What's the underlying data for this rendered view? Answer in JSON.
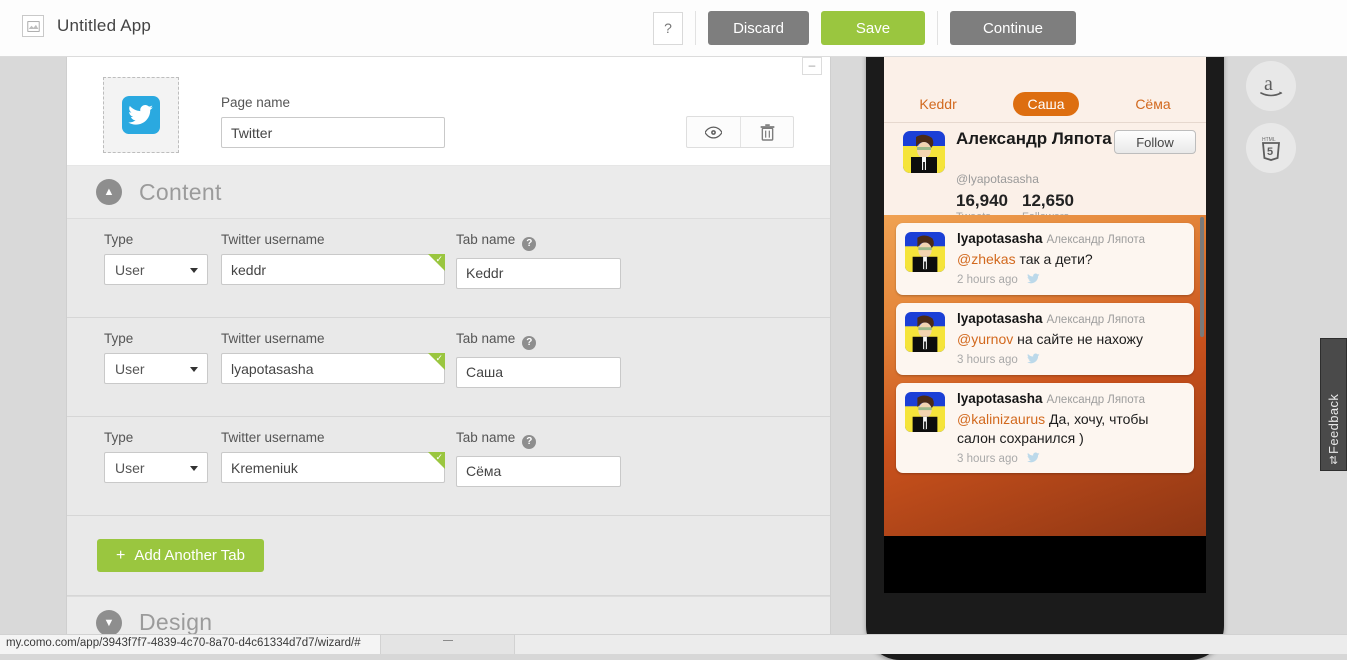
{
  "topbar": {
    "app_icon": "image-placeholder-icon",
    "app_title": "Untitled App",
    "help_label": "?",
    "discard_label": "Discard",
    "save_label": "Save",
    "continue_label": "Continue",
    "save_color": "#9ac63f",
    "grey_color": "#7e7e7e"
  },
  "panel": {
    "minimize_label": "–",
    "page_icon": "twitter-icon",
    "page_name_label": "Page name",
    "page_name_value": "Twitter",
    "preview_icon": "eye-icon",
    "delete_icon": "trash-icon"
  },
  "sections": {
    "content": {
      "title": "Content",
      "chevron": "chevron-up-icon",
      "expanded": true
    },
    "design": {
      "title": "Design",
      "chevron": "chevron-down-icon",
      "expanded": false
    }
  },
  "fields": {
    "type_label": "Type",
    "username_label": "Twitter username",
    "tabname_label": "Tab name",
    "help_badge": "?",
    "valid_mark": "✓"
  },
  "tabs": [
    {
      "type": "User",
      "username": "keddr",
      "tabname": "Keddr",
      "valid": true
    },
    {
      "type": "User",
      "username": "lyapotasasha",
      "tabname": "Саша",
      "valid": true
    },
    {
      "type": "User",
      "username": "Kremeniuk",
      "tabname": "Сёма",
      "valid": true
    }
  ],
  "add_button": {
    "plus": "+",
    "label": "Add Another Tab"
  },
  "preview": {
    "tabs": [
      {
        "label": "Keddr",
        "active": false
      },
      {
        "label": "Саша",
        "active": true
      },
      {
        "label": "Сёма",
        "active": false
      }
    ],
    "accent_color": "#dd6e10",
    "profile": {
      "name": "Александр Ляпота",
      "handle": "@lyapotasasha",
      "follow_label": "Follow",
      "tweets_count": "16,940",
      "tweets_label": "Tweets",
      "followers_count": "12,650",
      "followers_label": "Followers"
    },
    "tweets": [
      {
        "user": "lyapotasasha",
        "realname": "Александр Ляпота",
        "mention": "@zhekas",
        "text": " так а дети?",
        "time": "2 hours ago"
      },
      {
        "user": "lyapotasasha",
        "realname": "Александр Ляпота",
        "mention": "@yurnov",
        "text": " на сайте не нахожу",
        "time": "3 hours ago"
      },
      {
        "user": "lyapotasasha",
        "realname": "Александр Ляпота",
        "mention": "@kalinizaurus",
        "text": " Да, хочу, чтобы салон сохранился )",
        "time": "3 hours ago"
      }
    ],
    "navbar": [
      {
        "icon": "grid-tile-icon"
      },
      {
        "icon": "twitter-icon"
      }
    ]
  },
  "rail": {
    "amazon_icon": "amazon-icon",
    "html5_icon": "html5-icon"
  },
  "feedback": {
    "label": "Feedback",
    "arrows": "⇅"
  },
  "status": {
    "url": "my.como.com/app/3943f7f7-4839-4c70-8a70-d4c61334d7d7/wizard/#"
  }
}
